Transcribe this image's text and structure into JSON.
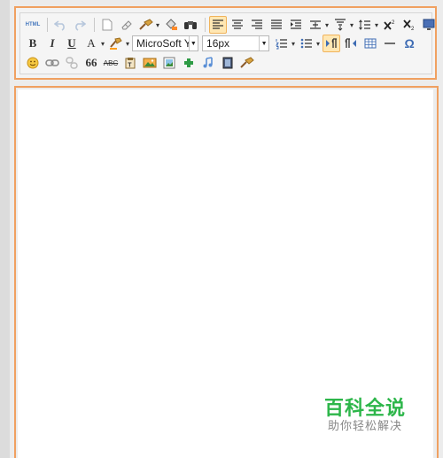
{
  "toolbar": {
    "html_label": "HTML",
    "bold_label": "B",
    "italic_label": "I",
    "underline_label": "U",
    "forecolor_label": "A",
    "font_family": "MicroSoft Y",
    "font_size": "16px",
    "quote_label": "66",
    "strikethrough_label": "ABC",
    "omega_label": "Ω"
  },
  "watermark": {
    "title": "百科全说",
    "subtitle": "助你轻松解决"
  },
  "colors": {
    "outline": "#f0a060",
    "active_fill": "#ffe7b3",
    "watermark_green": "#2db64a"
  }
}
